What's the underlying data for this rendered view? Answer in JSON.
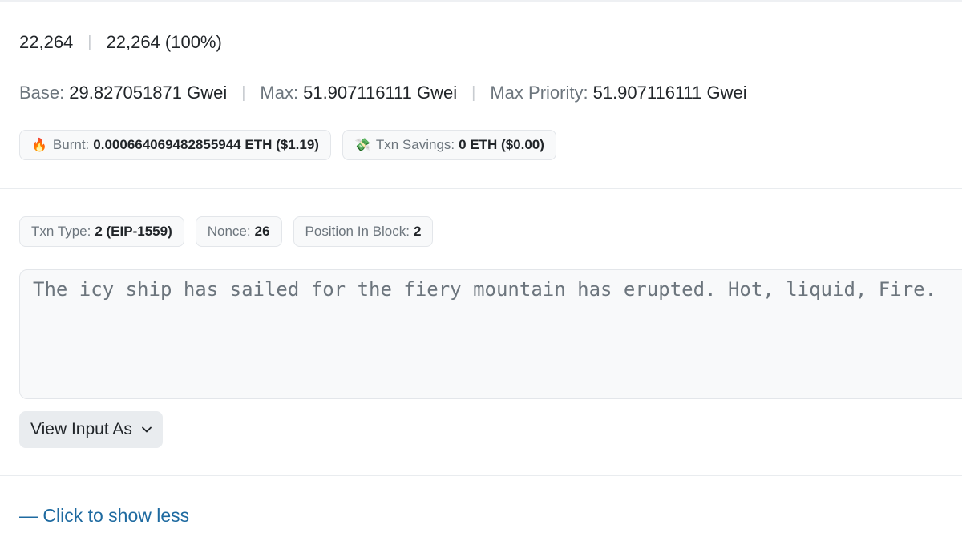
{
  "gas": {
    "limit": "22,264",
    "used": "22,264 (100%)"
  },
  "fees": {
    "base_label": "Base:",
    "base_value": "29.827051871 Gwei",
    "max_label": "Max:",
    "max_value": "51.907116111 Gwei",
    "priority_label": "Max Priority:",
    "priority_value": "51.907116111 Gwei"
  },
  "burn": {
    "burnt_icon": "fire-icon",
    "burnt_label": "Burnt:",
    "burnt_value": "0.000664069482855944 ETH ($1.19)",
    "savings_icon": "money-wings-icon",
    "savings_label": "Txn Savings:",
    "savings_value": "0 ETH ($0.00)"
  },
  "txn": {
    "type_label": "Txn Type:",
    "type_value": "2 (EIP-1559)",
    "nonce_label": "Nonce:",
    "nonce_value": "26",
    "position_label": "Position In Block:",
    "position_value": "2"
  },
  "input_data": {
    "text": "The icy ship has sailed for the fiery mountain has erupted. Hot, liquid, Fire."
  },
  "view_input": {
    "label": "View Input As",
    "icon": "chevron-down-icon"
  },
  "toggle": {
    "label": "— Click to show less"
  },
  "colors": {
    "link": "#1e6aa0",
    "muted": "#6c757d",
    "pill_bg": "#f8f9fa"
  }
}
